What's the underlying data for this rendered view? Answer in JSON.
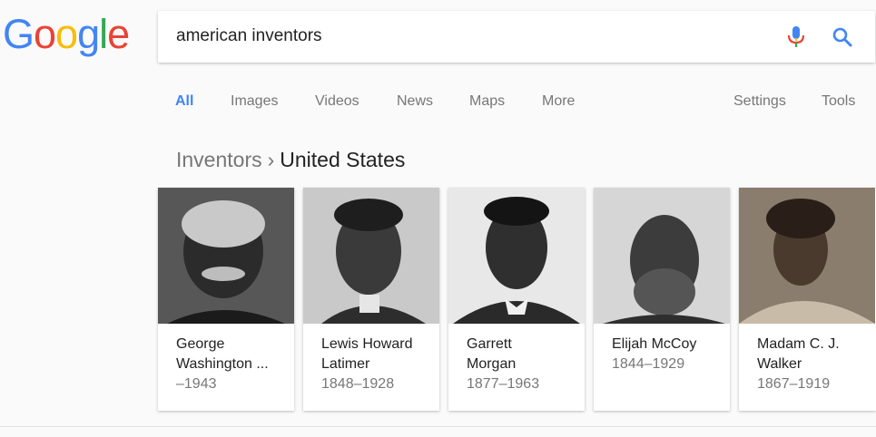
{
  "logo": {
    "letters": [
      "G",
      "o",
      "o",
      "g",
      "l",
      "e"
    ],
    "colors": [
      "#4285F4",
      "#EA4335",
      "#FBBC05",
      "#4285F4",
      "#34A853",
      "#EA4335"
    ]
  },
  "search": {
    "query": "american inventors"
  },
  "nav": {
    "tabs": [
      "All",
      "Images",
      "Videos",
      "News",
      "Maps",
      "More"
    ],
    "settings": "Settings",
    "tools": "Tools"
  },
  "breadcrumb": {
    "parent": "Inventors",
    "separator": "›",
    "current": "United States"
  },
  "cards": [
    {
      "name_line1": "George",
      "name_line2": "Washington ...",
      "years": "–1943"
    },
    {
      "name_line1": "Lewis Howard",
      "name_line2": "Latimer",
      "years": "1848–1928"
    },
    {
      "name_line1": "Garrett",
      "name_line2": "Morgan",
      "years": "1877–1963"
    },
    {
      "name_line1": "Elijah McCoy",
      "name_line2": "",
      "years": "1844–1929"
    },
    {
      "name_line1": "Madam C. J.",
      "name_line2": "Walker",
      "years": "1867–1919"
    }
  ]
}
